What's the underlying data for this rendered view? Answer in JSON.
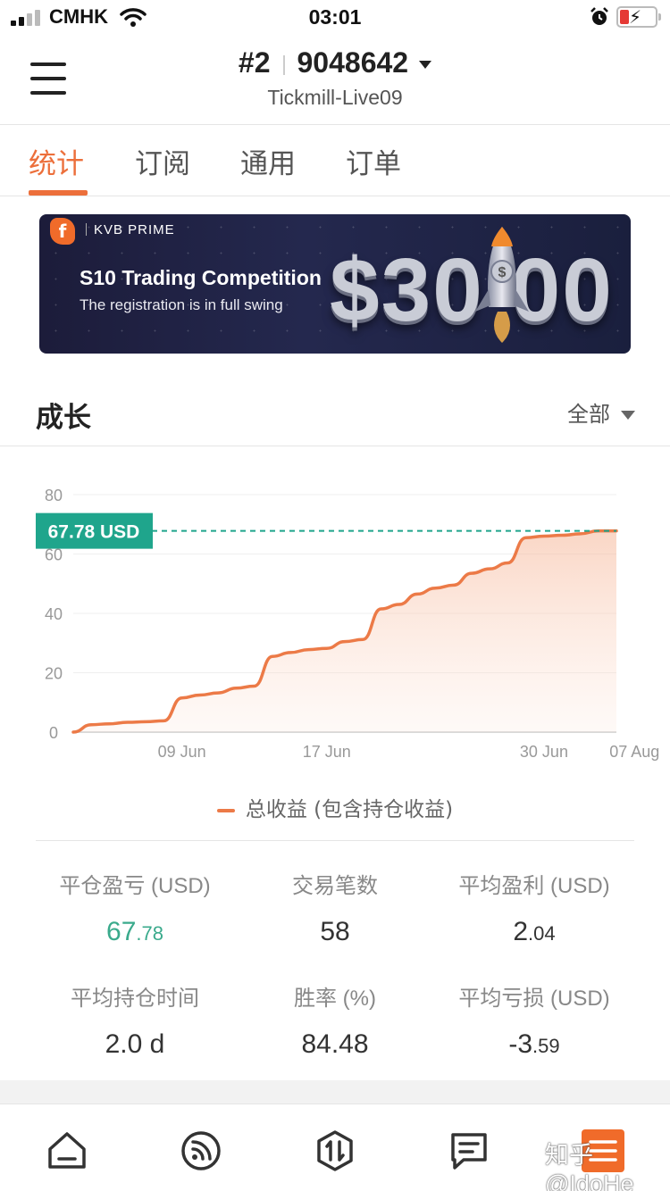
{
  "status_bar": {
    "carrier": "CMHK",
    "time": "03:01",
    "icons": [
      "signal-icon",
      "wifi-icon",
      "alarm-icon",
      "battery-charging-icon"
    ],
    "battery_color": "#e53935"
  },
  "header": {
    "account_index": "#2",
    "account_number": "9048642",
    "server": "Tickmill-Live09"
  },
  "tabs": [
    {
      "label": "统计",
      "active": true
    },
    {
      "label": "订阅",
      "active": false
    },
    {
      "label": "通用",
      "active": false
    },
    {
      "label": "订单",
      "active": false
    }
  ],
  "banner": {
    "brand": "KVB PRIME",
    "title": "S10 Trading Competition",
    "subtitle": "The registration is in full swing",
    "amount": "$30 00"
  },
  "growth": {
    "title": "成长",
    "filter": "全部"
  },
  "chart_data": {
    "type": "area",
    "x": [
      "",
      "",
      "",
      "",
      "",
      "",
      "09 Jun",
      "",
      "",
      "",
      "",
      "",
      "",
      "",
      "17 Jun",
      "",
      "",
      "",
      "",
      "",
      "",
      "",
      "",
      "",
      "",
      "",
      "30 Jun",
      "",
      "",
      "",
      "",
      "07 Aug",
      ""
    ],
    "x_ticks": [
      "09 Jun",
      "17 Jun",
      "30 Jun",
      "07 Aug"
    ],
    "series": [
      {
        "name": "总收益 (包含持仓收益)",
        "values": [
          0,
          2.5,
          2.8,
          3.3,
          3.5,
          3.8,
          11.5,
          12.5,
          13.2,
          14.8,
          15.5,
          25.5,
          26.8,
          27.8,
          28.2,
          30.5,
          31.2,
          41.5,
          43.0,
          46.5,
          48.5,
          49.5,
          53.5,
          55.0,
          57.0,
          65.5,
          66.0,
          66.3,
          66.8,
          67.78,
          67.78
        ]
      }
    ],
    "ylim": [
      0,
      80
    ],
    "y_ticks": [
      0,
      20,
      40,
      60,
      80
    ],
    "current_value_label": "67.78 USD",
    "current_value": 67.78,
    "grid": true,
    "legend_position": "bottom-center",
    "line_color": "#ec7a47",
    "marker_color": "#1fa58c"
  },
  "stats": [
    {
      "label": "平仓盈亏 (USD)",
      "int": "67",
      "dec": ".78",
      "color": "#3aaa8c"
    },
    {
      "label": "交易笔数",
      "int": "58",
      "dec": ""
    },
    {
      "label": "平均盈利 (USD)",
      "int": "2",
      "dec": ".04"
    },
    {
      "label": "平均持仓时间",
      "int": "2.0 d",
      "dec": ""
    },
    {
      "label": "胜率 (%)",
      "int": "84.48",
      "dec": ""
    },
    {
      "label": "平均亏损 (USD)",
      "int": "-3",
      "dec": ".59"
    }
  ],
  "bottom_nav": [
    {
      "icon": "home-icon"
    },
    {
      "icon": "feed-icon"
    },
    {
      "icon": "trade-icon"
    },
    {
      "icon": "orders-icon"
    },
    {
      "icon": "profile-icon"
    }
  ],
  "watermark": "知乎 @IdoHe"
}
